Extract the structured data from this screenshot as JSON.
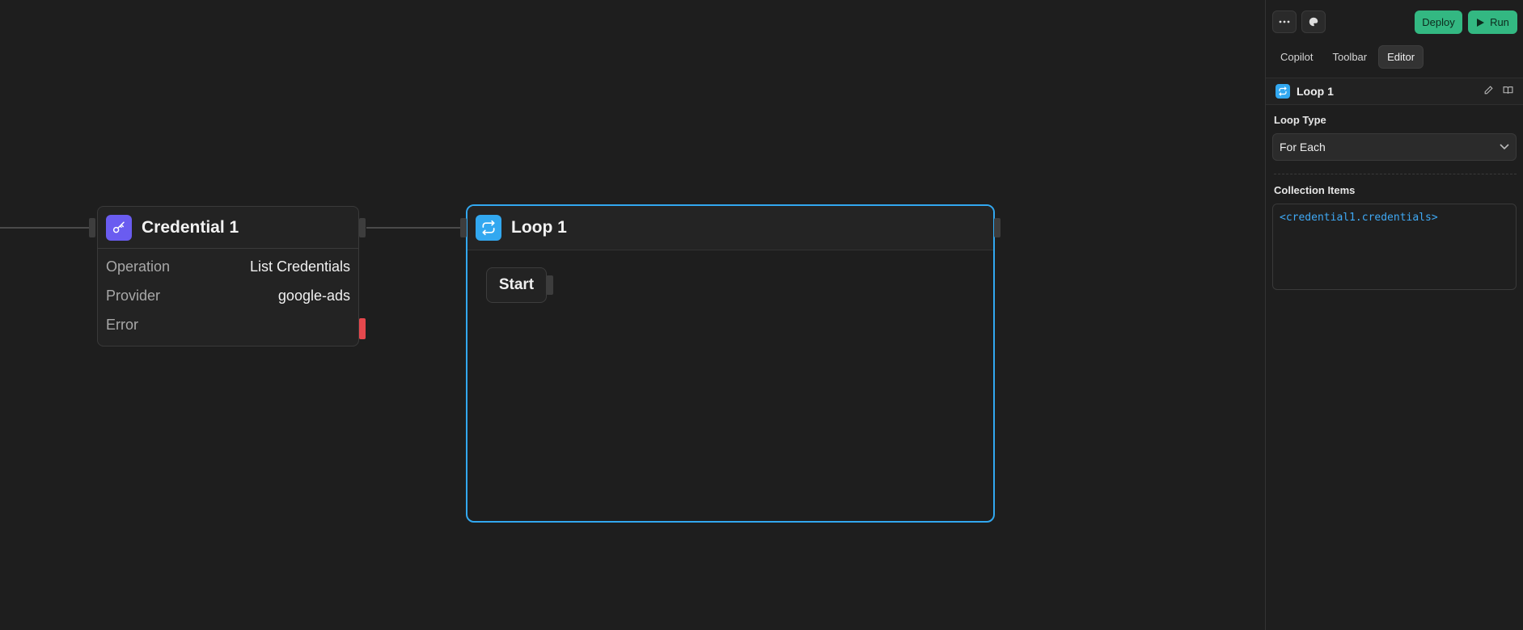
{
  "colors": {
    "accent_blue": "#32a8f0",
    "credential_purple": "#6a5cf0",
    "run_green": "#33b882",
    "error_red": "#e5484d",
    "canvas_bg": "#1e1e1e"
  },
  "credential_block": {
    "title": "Credential 1",
    "icon": "key-icon",
    "rows": [
      {
        "label": "Operation",
        "value": "List Credentials"
      },
      {
        "label": "Provider",
        "value": "google-ads"
      },
      {
        "label": "Error",
        "value": ""
      }
    ]
  },
  "loop_block": {
    "title": "Loop 1",
    "icon": "loop-icon",
    "start_label": "Start"
  },
  "panel": {
    "more_icon": "ellipsis-icon",
    "theme_icon": "palette-icon",
    "deploy_label": "Deploy",
    "run_label": "Run",
    "tabs": [
      {
        "label": "Copilot",
        "active": false
      },
      {
        "label": "Toolbar",
        "active": false
      },
      {
        "label": "Editor",
        "active": true
      }
    ],
    "editor": {
      "title": "Loop 1",
      "loop_type_label": "Loop Type",
      "loop_type_value": "For Each",
      "collection_label": "Collection Items",
      "collection_value": "<credential1.credentials>"
    }
  }
}
